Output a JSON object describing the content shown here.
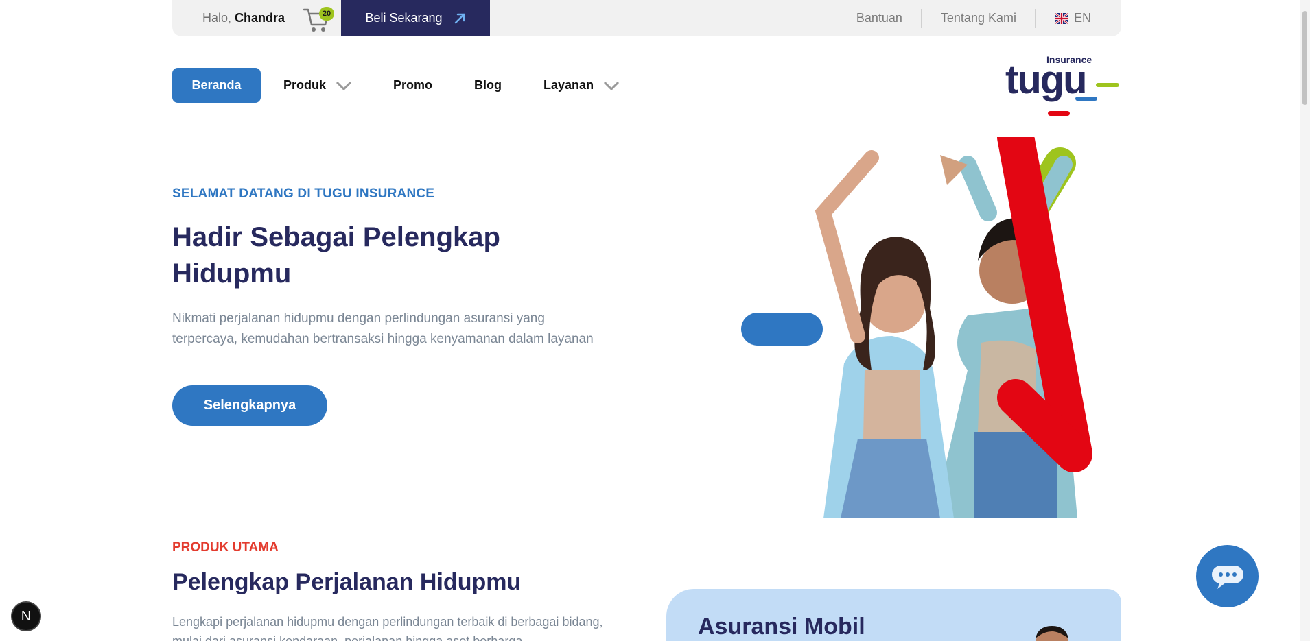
{
  "topbar": {
    "greeting_prefix": "Halo, ",
    "user_name": "Chandra",
    "cart_count": "20",
    "buy_label": "Beli Sekarang",
    "help_label": "Bantuan",
    "about_label": "Tentang Kami",
    "lang_label": "EN"
  },
  "nav": {
    "items": [
      {
        "label": "Beranda",
        "active": true
      },
      {
        "label": "Produk",
        "dropdown": true
      },
      {
        "label": "Promo"
      },
      {
        "label": "Blog"
      },
      {
        "label": "Layanan",
        "dropdown": true
      }
    ],
    "logo_caption": "Insurance",
    "logo_text": "tugu"
  },
  "hero": {
    "eyebrow": "SELAMAT DATANG DI TUGU INSURANCE",
    "title_line1": "Hadir Sebagai Pelengkap",
    "title_line2": "Hidupmu",
    "description": "Nikmati perjalanan hidupmu dengan perlindungan asuransi yang terpercaya, kemudahan bertransaksi hingga kenyamanan dalam layanan",
    "cta_label": "Selengkapnya"
  },
  "products": {
    "eyebrow": "PRODUK UTAMA",
    "title": "Pelengkap Perjalanan Hidupmu",
    "description": "Lengkapi perjalanan hidupmu dengan perlindungan terbaik di berbagai bidang, mulai dari asuransi kendaraan, perjalanan hingga aset berharga.",
    "card_title": "Asuransi Mobil"
  },
  "floating": {
    "next_badge": "N"
  },
  "colors": {
    "brand_blue": "#2f77c2",
    "brand_navy": "#27295e",
    "brand_green": "#9ec41e",
    "brand_red": "#e30613"
  }
}
